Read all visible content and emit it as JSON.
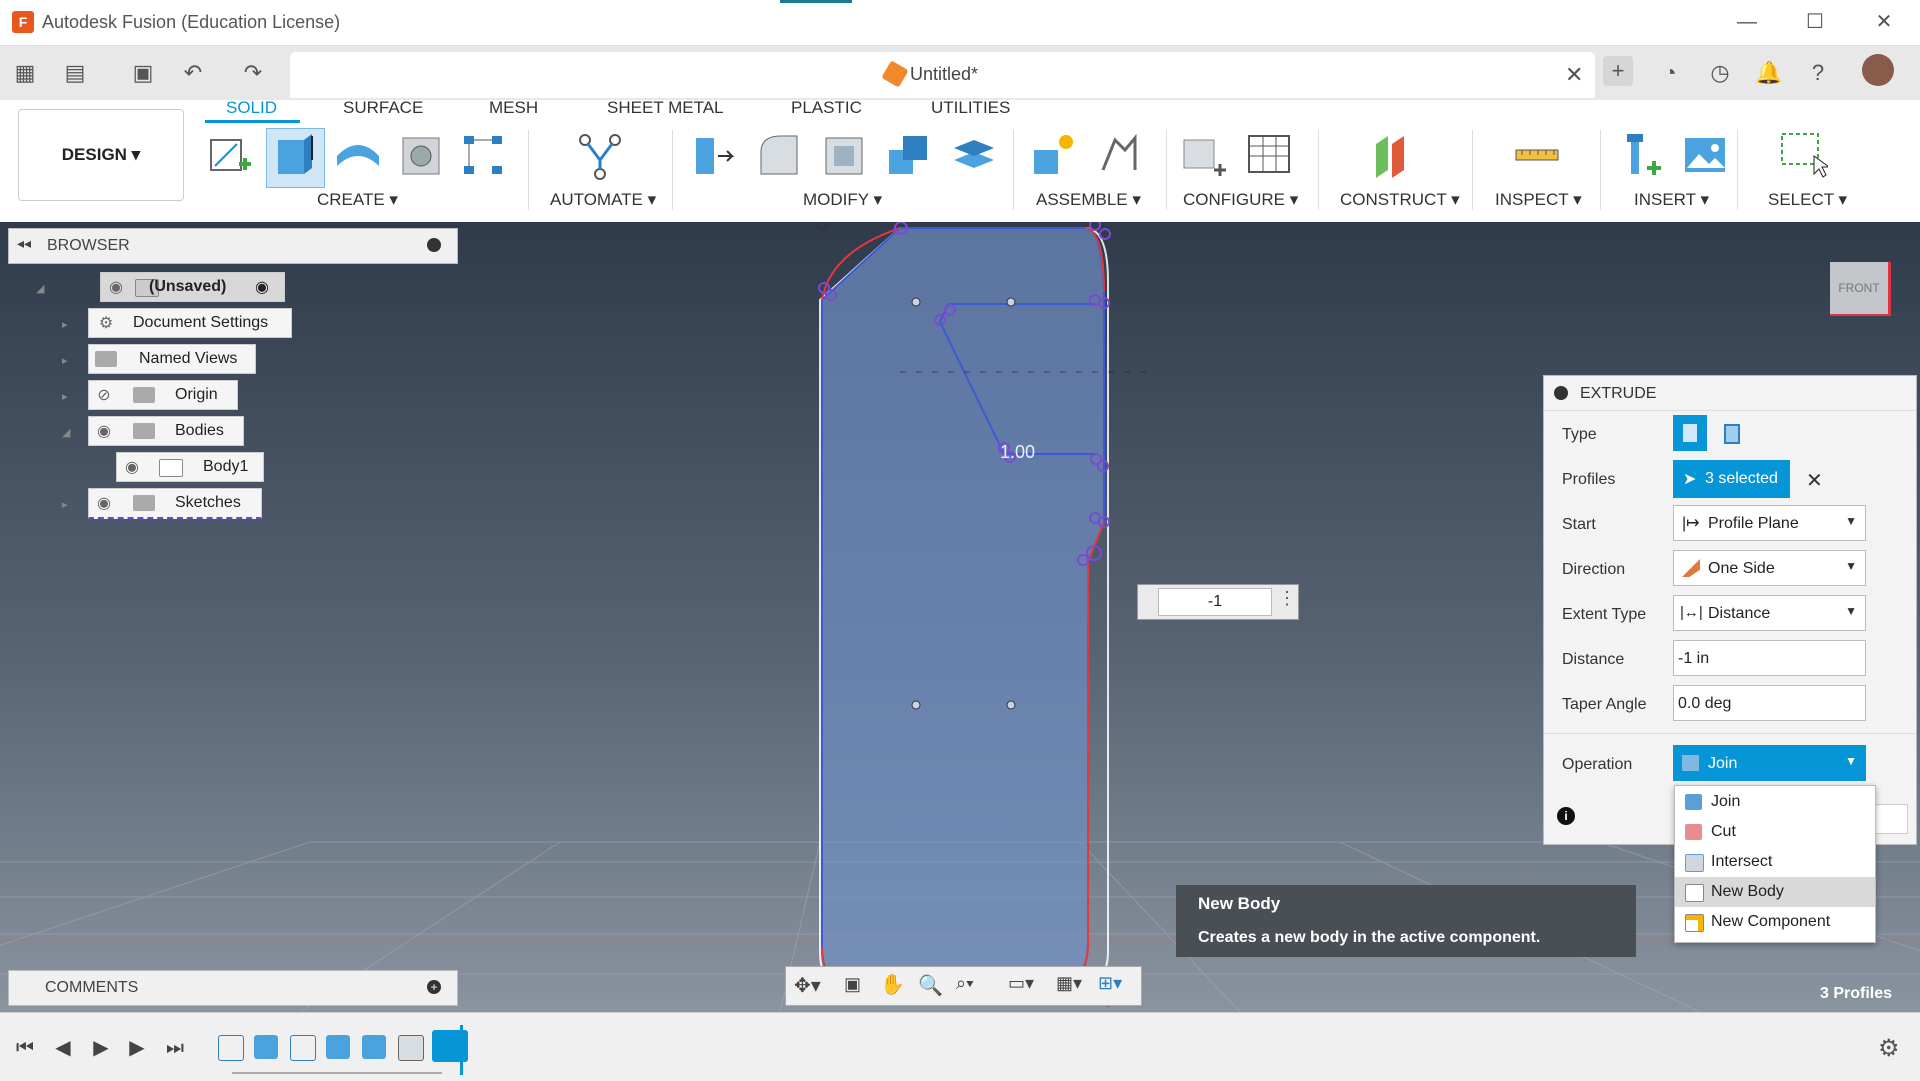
{
  "window": {
    "title": "Autodesk Fusion (Education License)"
  },
  "document": {
    "tab_title": "Untitled*"
  },
  "ribbon": {
    "workspace": "DESIGN",
    "tabs": [
      "SOLID",
      "SURFACE",
      "MESH",
      "SHEET METAL",
      "PLASTIC",
      "UTILITIES"
    ],
    "groups": [
      "CREATE",
      "AUTOMATE",
      "MODIFY",
      "ASSEMBLE",
      "CONFIGURE",
      "CONSTRUCT",
      "INSPECT",
      "INSERT",
      "SELECT"
    ]
  },
  "browser": {
    "title": "BROWSER",
    "root": "(Unsaved)",
    "items": [
      "Document Settings",
      "Named Views",
      "Origin",
      "Bodies",
      "Body1",
      "Sketches"
    ]
  },
  "comments": {
    "title": "COMMENTS"
  },
  "viewport": {
    "dimension_text": "1.00",
    "distance_input": "-1",
    "viewcube_label": "FRONT",
    "status": "3 Profiles"
  },
  "extrude": {
    "title": "EXTRUDE",
    "labels": {
      "type": "Type",
      "profiles": "Profiles",
      "start": "Start",
      "direction": "Direction",
      "extent_type": "Extent Type",
      "distance": "Distance",
      "taper_angle": "Taper Angle",
      "operation": "Operation"
    },
    "profiles_value": "3 selected",
    "start_value": "Profile Plane",
    "direction_value": "One Side",
    "extent_value": "Distance",
    "distance_value": "-1 in",
    "taper_value": "0.0 deg",
    "operation_value": "Join",
    "operation_options": [
      "Join",
      "Cut",
      "Intersect",
      "New Body",
      "New Component"
    ],
    "hovered_option": "New Body"
  },
  "tooltip": {
    "title": "New Body",
    "text": "Creates a new body in the active component."
  },
  "colors": {
    "accent": "#0696d7",
    "brand": "#e8581d",
    "sketch": "#6f8fc4",
    "profile_edge": "#e0393e"
  }
}
